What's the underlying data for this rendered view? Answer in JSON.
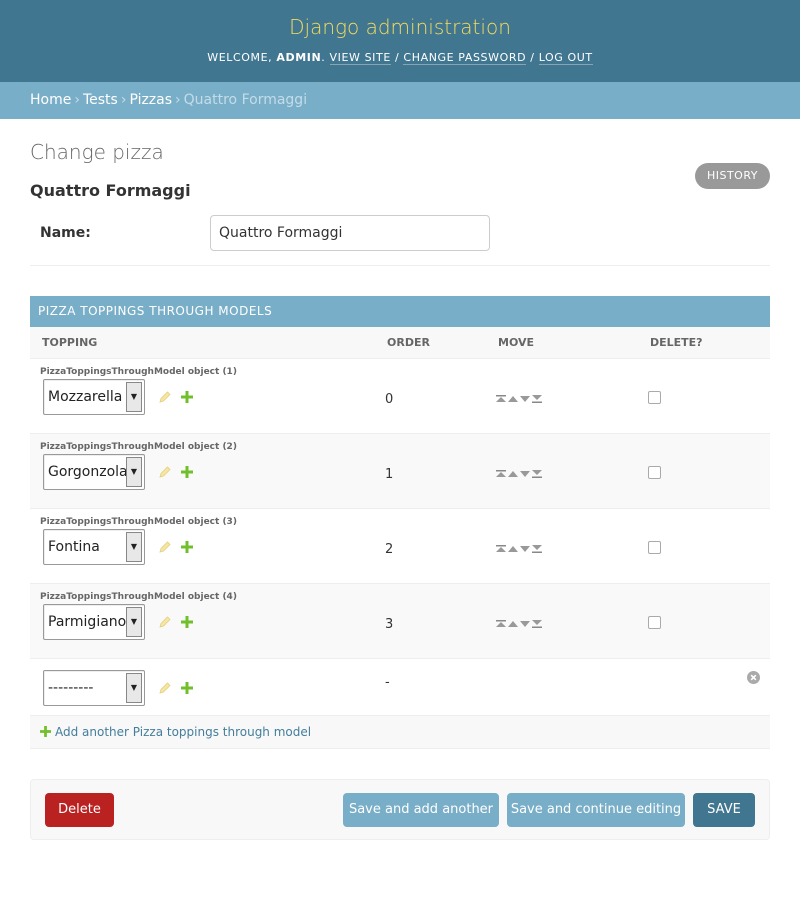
{
  "header": {
    "site_name": "Django administration",
    "welcome": "Welcome,",
    "username": "admin",
    "view_site": "View site",
    "change_password": "Change password",
    "logout": "Log out"
  },
  "breadcrumbs": {
    "home": "Home",
    "app": "Tests",
    "model": "Pizzas",
    "current": "Quattro Formaggi"
  },
  "page": {
    "title": "Change pizza",
    "history": "History",
    "object_title": "Quattro Formaggi"
  },
  "form": {
    "name_label": "Name:",
    "name_value": "Quattro Formaggi"
  },
  "inline": {
    "title": "Pizza toppings through models",
    "columns": [
      "Topping",
      "Order",
      "Move",
      "Delete?"
    ],
    "rows": [
      {
        "label": "PizzaToppingsThroughModel object (1)",
        "topping": "Mozzarella",
        "order": "0"
      },
      {
        "label": "PizzaToppingsThroughModel object (2)",
        "topping": "Gorgonzola",
        "order": "1"
      },
      {
        "label": "PizzaToppingsThroughModel object (3)",
        "topping": "Fontina",
        "order": "2"
      },
      {
        "label": "PizzaToppingsThroughModel object (4)",
        "topping": "Parmigiano",
        "order": "3"
      }
    ],
    "new_row": {
      "topping": "---------",
      "order": "-"
    },
    "add_another": "Add another Pizza toppings through model"
  },
  "submit": {
    "delete": "Delete",
    "save_add_another": "Save and add another",
    "save_continue": "Save and continue editing",
    "save": "SAVE"
  },
  "colors": {
    "header_bg": "#417690",
    "site_name": "#f5dd5d",
    "breadcrumbs_bg": "#79aec8",
    "delete_button": "#ba2121",
    "add_green": "#70bf2b"
  }
}
